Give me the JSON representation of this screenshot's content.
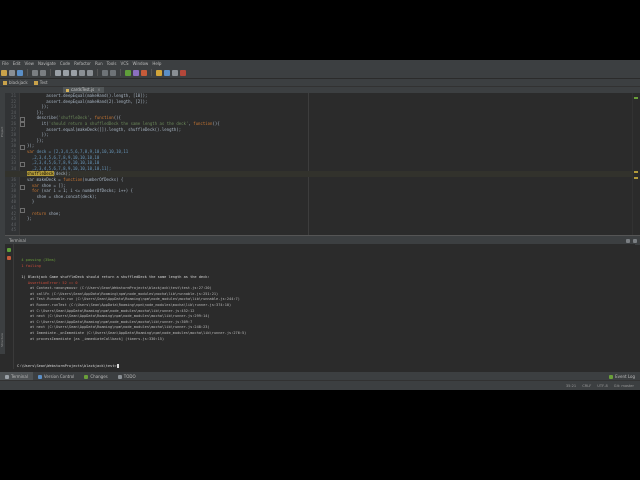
{
  "menu": [
    "File",
    "Edit",
    "View",
    "Navigate",
    "Code",
    "Refactor",
    "Run",
    "Tools",
    "VCS",
    "Window",
    "Help"
  ],
  "breadcrumb": [
    "blackjack",
    "Test"
  ],
  "tab": {
    "label": "cardsTest.js",
    "close": "×"
  },
  "line_numbers": [
    "21",
    "22",
    "23",
    "24",
    "25",
    "26",
    "27",
    "28",
    "29",
    "30",
    "31",
    "32",
    "33",
    "34",
    "35",
    "36",
    "37",
    "38",
    "39",
    "40",
    "41",
    "42",
    "43",
    "44",
    "45"
  ],
  "code": {
    "l21": "        assert.deepEqual(makeHand().length, [10]);",
    "l22": "        assert.deepEqual(makeHand(2).length, [2]);",
    "l23": "      });",
    "l24": "    });",
    "l25_a": "    describe(",
    "l25_s": "'shuffleDeck'",
    "l25_b": ", ",
    "l25_k": "function",
    "l25_c": "(){",
    "l26_a": "      it(",
    "l26_s": "'should return a shuffledDeck the same length as the deck'",
    "l26_b": ", ",
    "l26_k": "function",
    "l26_c": "(){",
    "l27": "        assert.equal(makeDeck([]).length, shuffleDeck().length);",
    "l28": "      });",
    "l29": "    });",
    "l30": "});",
    "l31_k": "var",
    "l31_a": " deck = [2,3,4,5,6,7,8,9,10,10,10,10,11",
    "l32": "  ,2,3,4,5,6,7,8,9,10,10,10,10",
    "l33": "  ,2,3,4,5,6,7,8,9,10,10,10,10",
    "l34": "  ,2,3,4,5,6,7,8,9,10,10,10,10,11];",
    "l35_s": "shuffleDeck",
    "l35_a": "(deck);",
    "l36_a": "var makeDeck = ",
    "l36_k": "function",
    "l36_b": "(numberOfDecks) {",
    "l37_k": "  var",
    "l37_a": " shoe = [];",
    "l38_k": "  for",
    "l38_a": " (var i = 1; i <= numberOfDecks; i++) {",
    "l39": "    shoe = shoe.concat(deck);",
    "l40": "  }",
    "l41": "",
    "l42_k": "  return",
    "l42_a": " shoe;",
    "l43": "};",
    "l44": "",
    "l45": ""
  },
  "terminal": {
    "title": "Terminal",
    "passing": "  4 passing (35ms)",
    "failing": "  1 failing",
    "fail_title": "  1) Blackjack Game shuffleDeck should return a shuffledDeck the same length as the deck:",
    "assertion": "     AssertionError: 52 == 0",
    "stack": [
      "      at Context.<anonymous> (C:\\Users\\Sean\\WebstormProjects\\blackjack\\test\\test.js:27:20)",
      "      at callFn (C:\\Users\\Sean\\AppData\\Roaming\\npm\\node_modules\\mocha\\lib\\runnable.js:251:21)",
      "      at Test.Runnable.run (C:\\Users\\Sean\\AppData\\Roaming\\npm\\node_modules\\mocha\\lib\\runnable.js:244:7)",
      "      at Runner.runTest (C:\\Users\\Sean\\AppData\\Roaming\\npm\\node_modules\\mocha\\lib\\runner.js:374:10)",
      "      at C:\\Users\\Sean\\AppData\\Roaming\\npm\\node_modules\\mocha\\lib\\runner.js:452:12",
      "      at next (C:\\Users\\Sean\\AppData\\Roaming\\npm\\node_modules\\mocha\\lib\\runner.js:299:14)",
      "      at C:\\Users\\Sean\\AppData\\Roaming\\npm\\node_modules\\mocha\\lib\\runner.js:309:7",
      "      at next (C:\\Users\\Sean\\AppData\\Roaming\\npm\\node_modules\\mocha\\lib\\runner.js:248:23)",
      "      at Immediate._onImmediate (C:\\Users\\Sean\\AppData\\Roaming\\npm\\node_modules\\mocha\\lib\\runner.js:276:5)",
      "      at processImmediate [as _immediateCallback] (timers.js:330:15)"
    ],
    "prompt": "C:\\Users\\Sean\\WebstormProjects\\blackjack\\test>"
  },
  "bottom_tabs": [
    "Terminal",
    "Version Control",
    "Changes",
    "TODO"
  ],
  "event_log": "Event Log",
  "status": {
    "left": "",
    "pos": "35:21",
    "sep": "CRLF",
    "enc": "UTF-8",
    "git": "Git: master"
  },
  "colors": {
    "accent": "#cc7832",
    "string": "#6a8759",
    "pass": "#6a9f3a",
    "fail": "#cc4b3a"
  }
}
